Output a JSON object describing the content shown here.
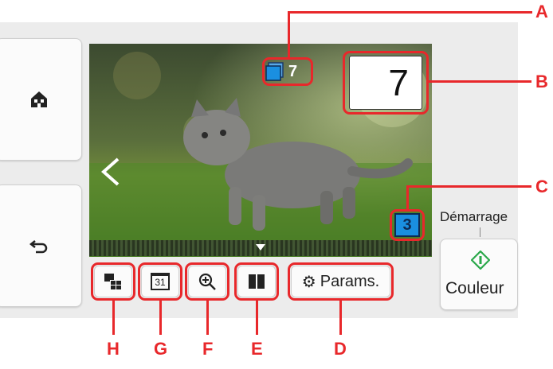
{
  "photo": {
    "selected_count": "7",
    "total_selected": "7",
    "copies": "7",
    "sheets": "3"
  },
  "start": {
    "label": "Démarrage",
    "color_button_label": "Couleur"
  },
  "toolbar": {
    "settings_label": "Params.",
    "calendar_day": "31"
  },
  "callouts": [
    "A",
    "B",
    "C",
    "D",
    "E",
    "F",
    "G",
    "H"
  ],
  "colors": {
    "callout": "#e8282b",
    "accent_green": "#2aa84a",
    "badge_blue": "#1a8fe0"
  }
}
